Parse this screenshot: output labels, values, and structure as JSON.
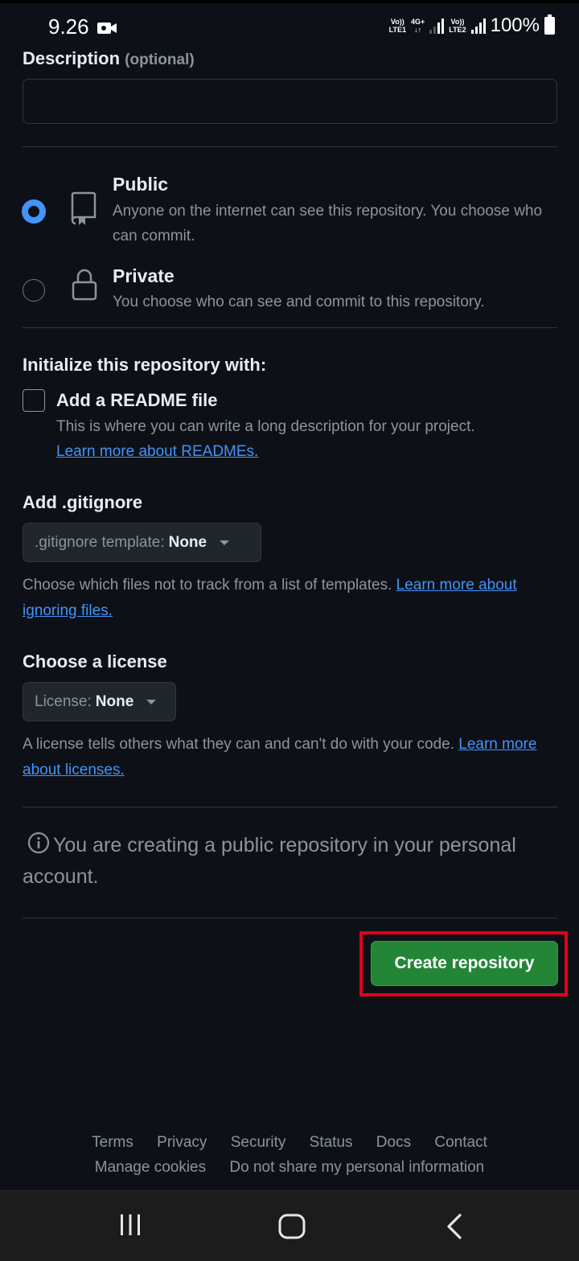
{
  "status_bar": {
    "time": "9.26",
    "sim1_top": "Vo))",
    "sim1_bottom": "LTE1",
    "net_type_top": "4G+",
    "net_type_bottom": "↓↑",
    "sim2_top": "Vo))",
    "sim2_bottom": "LTE2",
    "battery": "100%"
  },
  "form": {
    "description_label": "Description",
    "description_optional": "(optional)",
    "description_value": "",
    "visibility": {
      "public_title": "Public",
      "public_text": "Anyone on the internet can see this repository. You choose who can commit.",
      "private_title": "Private",
      "private_text": "You choose who can see and commit to this repository.",
      "selected": "public"
    },
    "init_heading": "Initialize this repository with:",
    "readme_title": "Add a README file",
    "readme_text": "This is where you can write a long description for your project.",
    "readme_link": "Learn more about READMEs.",
    "readme_checked": false,
    "gitignore_heading": "Add .gitignore",
    "gitignore_select_label": ".gitignore template:",
    "gitignore_select_value": "None",
    "gitignore_help": "Choose which files not to track from a list of templates.",
    "gitignore_link": "Learn more about ignoring files.",
    "license_heading": "Choose a license",
    "license_select_label": "License:",
    "license_select_value": "None",
    "license_help": "A license tells others what they can and can't do with your code.",
    "license_link": "Learn more about licenses.",
    "notice": "You are creating a public repository in your personal account.",
    "create_button": "Create repository"
  },
  "footer": {
    "links_row1": [
      "Terms",
      "Privacy",
      "Security",
      "Status",
      "Docs",
      "Contact"
    ],
    "links_row2": [
      "Manage cookies",
      "Do not share my personal information"
    ]
  },
  "colors": {
    "background": "#0d1117",
    "accent_blue": "#4493f8",
    "button_green": "#238636",
    "highlight_red": "#e3001b"
  },
  "icons": [
    "video-camera-icon",
    "signal-icon",
    "battery-icon",
    "repo-icon",
    "lock-icon",
    "info-icon",
    "caret-down-icon",
    "recent-apps-icon",
    "home-icon",
    "back-icon"
  ]
}
